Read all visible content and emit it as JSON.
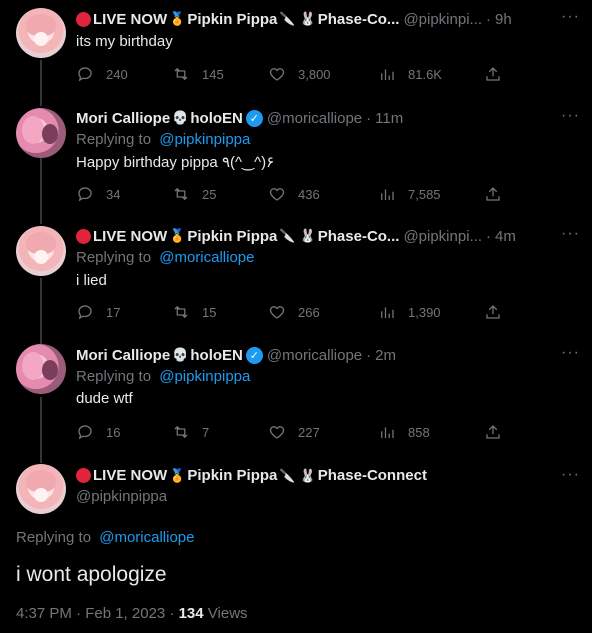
{
  "tweets": [
    {
      "name": "LIVE NOW",
      "name2": "Pipkin Pippa",
      "name3": "Phase-Co...",
      "handle": "@pipkinpi...",
      "time": "9h",
      "text": "its my birthday",
      "reply_to_label": "",
      "reply_to_handle": "",
      "replies": "240",
      "retweets": "145",
      "likes": "3,800",
      "views": "81.6K"
    },
    {
      "name": "Mori Calliope",
      "name2": "holoEN",
      "handle": "@moricalliope",
      "time": "11m",
      "reply_to_label": "Replying to",
      "reply_to_handle": "@pipkinpippa",
      "text": "Happy birthday pippa ٩(^‿^)۶",
      "replies": "34",
      "retweets": "25",
      "likes": "436",
      "views": "7,585"
    },
    {
      "name": "LIVE NOW",
      "name2": "Pipkin Pippa",
      "name3": "Phase-Co...",
      "handle": "@pipkinpi...",
      "time": "4m",
      "reply_to_label": "Replying to",
      "reply_to_handle": "@moricalliope",
      "text": "i lied",
      "replies": "17",
      "retweets": "15",
      "likes": "266",
      "views": "1,390"
    },
    {
      "name": "Mori Calliope",
      "name2": "holoEN",
      "handle": "@moricalliope",
      "time": "2m",
      "reply_to_label": "Replying to",
      "reply_to_handle": "@pipkinpippa",
      "text": "dude wtf",
      "replies": "16",
      "retweets": "7",
      "likes": "227",
      "views": "858"
    }
  ],
  "main": {
    "name": "LIVE NOW",
    "name2": "Pipkin Pippa",
    "name3": "Phase-Connect",
    "handle": "@pipkinpippa",
    "reply_to_label": "Replying to",
    "reply_to_handle": "@moricalliope",
    "text": "i wont apologize",
    "timestamp": "4:37 PM · Feb 1, 2023 · ",
    "views_count": "134",
    "views_label": " Views"
  },
  "icons": {
    "reply": "reply-icon",
    "retweet": "retweet-icon",
    "like": "heart-icon",
    "views": "views-icon",
    "share": "share-icon",
    "more": "more-icon",
    "verified": "verified-icon"
  },
  "colors": {
    "background": "#000000",
    "text": "#e7e9ea",
    "muted": "#71767b",
    "link": "#1d9bf0",
    "live": "#e0243b"
  }
}
